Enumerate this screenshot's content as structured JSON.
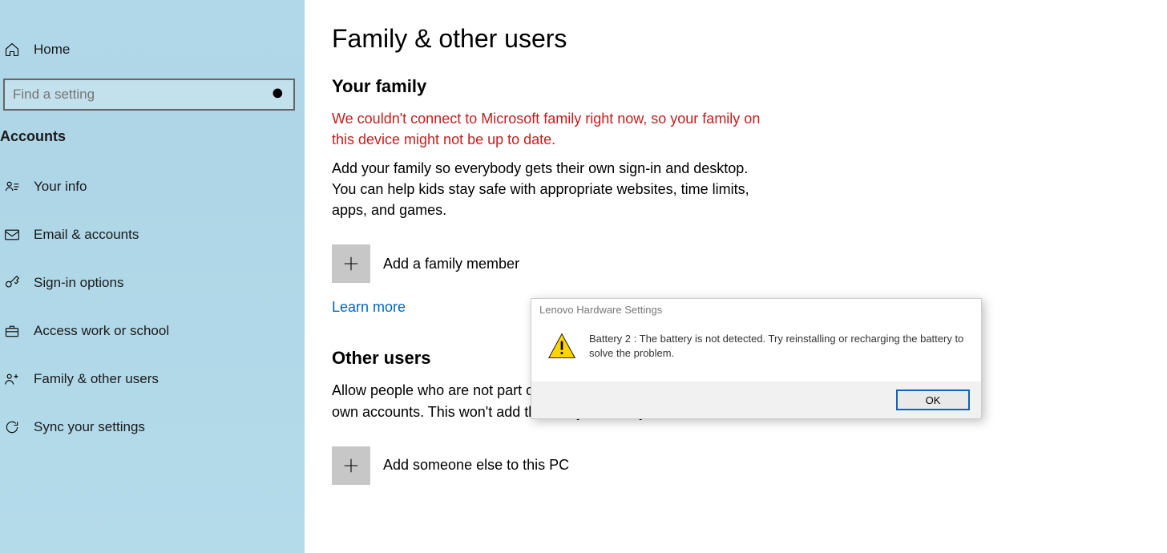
{
  "sidebar": {
    "home_label": "Home",
    "search_placeholder": "Find a setting",
    "section_title": "Accounts",
    "items": [
      {
        "label": "Your info"
      },
      {
        "label": "Email & accounts"
      },
      {
        "label": "Sign-in options"
      },
      {
        "label": "Access work or school"
      },
      {
        "label": "Family & other users"
      },
      {
        "label": "Sync your settings"
      }
    ]
  },
  "main": {
    "page_title": "Family & other users",
    "family_heading": "Your family",
    "family_error": "We couldn't connect to Microsoft family right now, so your family on this device might not be up to date.",
    "family_desc": "Add your family so everybody gets their own sign-in and desktop. You can help kids stay safe with appropriate websites, time limits, apps, and games.",
    "add_family_label": "Add a family member",
    "learn_more": "Learn more",
    "others_heading": "Other users",
    "others_desc": "Allow people who are not part of your family to sign in with their own accounts. This won't add them to your family.",
    "add_other_label": "Add someone else to this PC"
  },
  "dialog": {
    "title": "Lenovo Hardware Settings",
    "message": "Battery 2 : The battery is not detected. Try reinstalling or recharging the battery to solve the problem.",
    "ok_label": "OK"
  }
}
